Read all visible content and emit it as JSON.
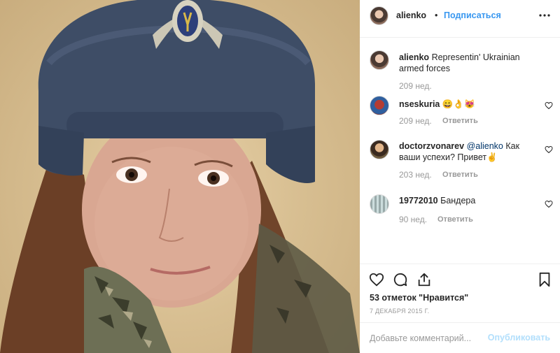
{
  "post": {
    "username": "alienko",
    "separator": "•",
    "follow_label": "Подписаться",
    "photo_description_icon": "selfie-photo"
  },
  "caption": {
    "username": "alienko",
    "text": "Representin' Ukrainian armed forces",
    "time": "209 нед."
  },
  "comments": [
    {
      "username": "nseskuria",
      "text": "😄👌😻",
      "time": "209 нед.",
      "reply_label": "Ответить"
    },
    {
      "username": "doctorzvonarev",
      "mention": "@alienko",
      "text": "Как ваши успехи? Привет✌",
      "time": "203 нед.",
      "reply_label": "Ответить"
    },
    {
      "username": "19772010",
      "text": "Бандера",
      "time": "90 нед.",
      "reply_label": "Ответить"
    }
  ],
  "actions": {
    "likes": "53 отметок \"Нравится\"",
    "date": "7 ДЕКАБРЯ 2015 Г."
  },
  "add_comment": {
    "placeholder": "Добавьте комментарий...",
    "post_label": "Опубликовать"
  },
  "colors": {
    "link_blue": "#3897f0",
    "muted": "#999999",
    "text": "#262626",
    "post_disabled": "#b2dffc"
  }
}
